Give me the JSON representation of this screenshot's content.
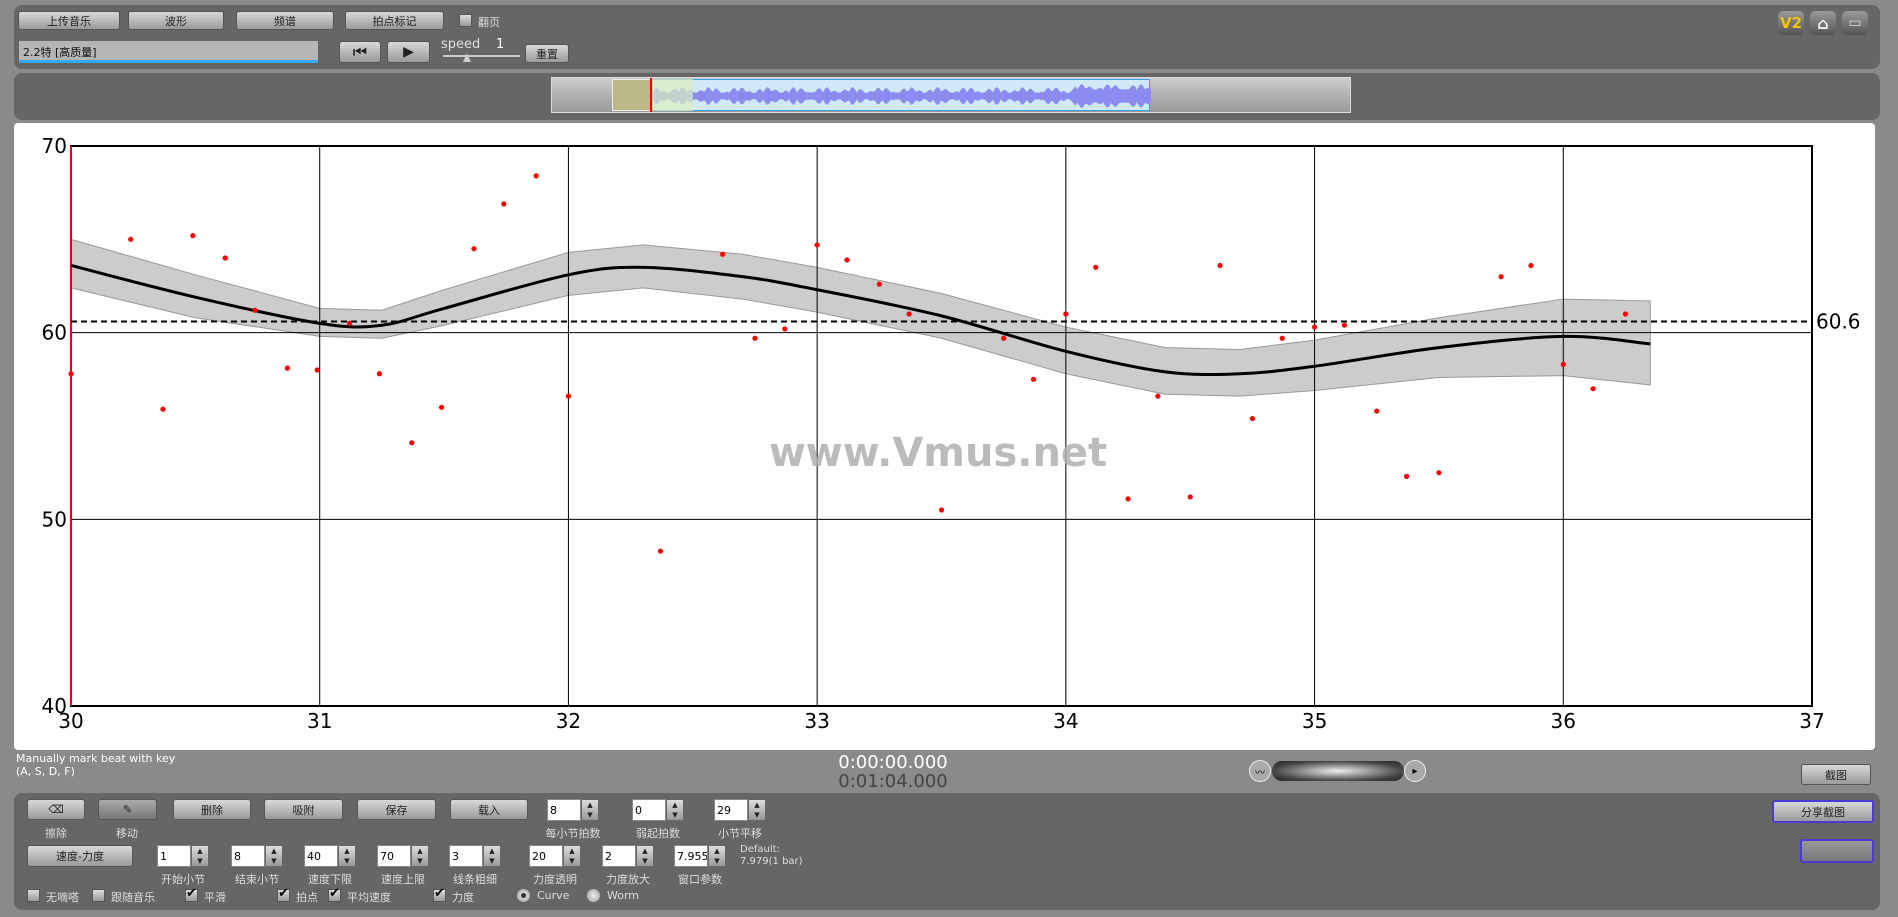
{
  "toolbar": {
    "upload": "上传音乐",
    "waveform": "波形",
    "spectrum": "频谱",
    "beat_mark": "拍点标记",
    "page_turn": "翻页",
    "track": "2.2特 [高质量]",
    "speed_label": "speed",
    "speed_value": "1",
    "reset": "重置",
    "v2": "V2"
  },
  "status": {
    "hint1": "Manually mark beat with key",
    "hint2": "(A, S, D, F)",
    "time_current": "0:00:00.000",
    "time_total": "0:01:04.000",
    "screenshot": "截图"
  },
  "watermark": "www.Vmus.net",
  "bottom": {
    "erase": "擦除",
    "move": "移动",
    "delete": "删除",
    "snap": "吸附",
    "save": "保存",
    "load": "载入",
    "tempo_dynamics": "速度-力度",
    "row1_spinners": [
      {
        "label": "每小节拍数",
        "value": "8"
      },
      {
        "label": "弱起拍数",
        "value": "0"
      },
      {
        "label": "小节平移",
        "value": "29"
      }
    ],
    "row2_spinners": [
      {
        "label": "开始小节",
        "value": "1"
      },
      {
        "label": "结束小节",
        "value": "8"
      },
      {
        "label": "速度下限",
        "value": "40"
      },
      {
        "label": "速度上限",
        "value": "70"
      },
      {
        "label": "线条粗细",
        "value": "3"
      },
      {
        "label": "力度透明",
        "value": "20"
      },
      {
        "label": "力度放大",
        "value": "2"
      },
      {
        "label": "窗口参数",
        "value": "7.9551"
      }
    ],
    "default1": "Default:",
    "default2": "7.979(1 bar)",
    "checks": [
      {
        "label": "无嘀嗒",
        "checked": false
      },
      {
        "label": "跟随音乐",
        "checked": false
      },
      {
        "label": "平滑",
        "checked": true
      },
      {
        "label": "拍点",
        "checked": true
      },
      {
        "label": "平均速度",
        "checked": true
      },
      {
        "label": "力度",
        "checked": true
      }
    ],
    "radios": [
      {
        "label": "Curve",
        "selected": true
      },
      {
        "label": "Worm",
        "selected": false
      }
    ],
    "share": "分享截图"
  },
  "chart_data": {
    "type": "scatter",
    "xlim": [
      30,
      37
    ],
    "ylim": [
      40,
      70
    ],
    "xticks": [
      "30",
      "31",
      "32",
      "33",
      "34",
      "35",
      "36",
      "37"
    ],
    "yticks": [
      "40",
      "50",
      "60",
      "70"
    ],
    "grid": true,
    "mean_line": {
      "value": 60.6,
      "label": "60.6"
    },
    "point_color": "#ff0000",
    "points": [
      [
        30.0,
        57.8
      ],
      [
        30.24,
        65.0
      ],
      [
        30.37,
        55.9
      ],
      [
        30.49,
        65.2
      ],
      [
        30.62,
        64.0
      ],
      [
        30.74,
        61.2
      ],
      [
        30.87,
        58.1
      ],
      [
        30.99,
        58.0
      ],
      [
        31.12,
        60.5
      ],
      [
        31.24,
        57.8
      ],
      [
        31.37,
        54.1
      ],
      [
        31.49,
        56.0
      ],
      [
        31.62,
        64.5
      ],
      [
        31.74,
        66.9
      ],
      [
        31.87,
        68.4
      ],
      [
        32.0,
        56.6
      ],
      [
        32.37,
        48.3
      ],
      [
        32.62,
        64.2
      ],
      [
        32.75,
        59.7
      ],
      [
        32.87,
        60.2
      ],
      [
        33.0,
        64.7
      ],
      [
        33.12,
        63.9
      ],
      [
        33.25,
        62.6
      ],
      [
        33.37,
        61.0
      ],
      [
        33.5,
        50.5
      ],
      [
        33.75,
        59.7
      ],
      [
        33.87,
        57.5
      ],
      [
        34.0,
        61.0
      ],
      [
        34.12,
        63.5
      ],
      [
        34.25,
        51.1
      ],
      [
        34.37,
        56.6
      ],
      [
        34.5,
        51.2
      ],
      [
        34.62,
        63.6
      ],
      [
        34.75,
        55.4
      ],
      [
        34.87,
        59.7
      ],
      [
        35.0,
        60.3
      ],
      [
        35.12,
        60.4
      ],
      [
        35.25,
        55.8
      ],
      [
        35.37,
        52.3
      ],
      [
        35.5,
        52.5
      ],
      [
        35.75,
        63.0
      ],
      [
        35.87,
        63.6
      ],
      [
        36.0,
        58.3
      ],
      [
        36.12,
        57.0
      ],
      [
        36.25,
        61.0
      ]
    ],
    "smooth_curve": [
      [
        30,
        63.6,
        65.0,
        62.4
      ],
      [
        30.5,
        61.9,
        63.1,
        60.8
      ],
      [
        31,
        60.5,
        61.3,
        59.8
      ],
      [
        31.25,
        60.4,
        61.2,
        59.7
      ],
      [
        31.5,
        61.3,
        62.3,
        60.4
      ],
      [
        32,
        63.1,
        64.3,
        62.0
      ],
      [
        32.3,
        63.5,
        64.7,
        62.4
      ],
      [
        32.7,
        63.0,
        64.2,
        61.8
      ],
      [
        33,
        62.3,
        63.5,
        61.1
      ],
      [
        33.5,
        60.9,
        62.1,
        59.7
      ],
      [
        34,
        59.0,
        60.3,
        57.8
      ],
      [
        34.4,
        57.9,
        59.2,
        56.7
      ],
      [
        34.7,
        57.8,
        59.1,
        56.6
      ],
      [
        35,
        58.2,
        59.6,
        56.9
      ],
      [
        35.5,
        59.2,
        60.8,
        57.6
      ],
      [
        36,
        59.8,
        61.8,
        57.7
      ],
      [
        36.35,
        59.4,
        61.7,
        57.2
      ]
    ]
  }
}
